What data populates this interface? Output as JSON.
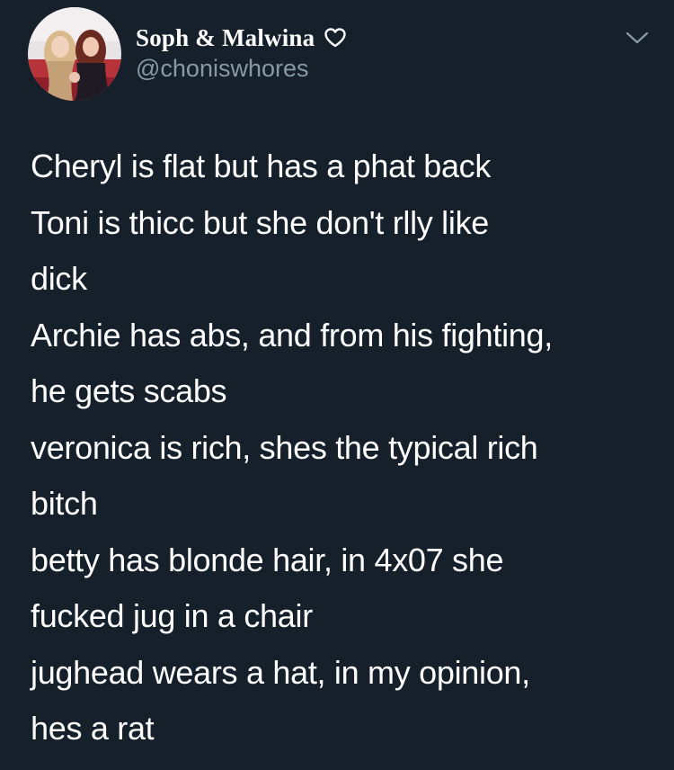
{
  "author": {
    "display_name": "Soph & Malwina",
    "handle": "@choniswhores",
    "name_badge_icon": "heart-outline-icon",
    "avatar_icon": "profile-photo"
  },
  "menu": {
    "icon": "chevron-down-icon"
  },
  "tweet": {
    "lines": [
      "Cheryl is flat but has a phat back",
      "Toni is thicc but she don't rlly like",
      "dick",
      "Archie has abs, and from his fighting,",
      "he gets scabs",
      "veronica is rich, shes the typical rich",
      "bitch",
      "betty has blonde hair, in 4x07 she",
      "fucked jug in a chair",
      "jughead wears a hat, in my opinion,",
      "hes a rat"
    ]
  },
  "colors": {
    "background": "#15202b",
    "text_primary": "#ffffff",
    "text_secondary": "#8899a6"
  }
}
